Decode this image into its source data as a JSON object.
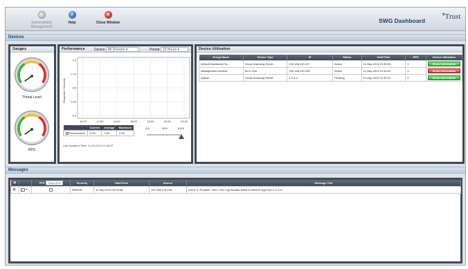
{
  "toolbar": {
    "buttons": [
      {
        "label": "Vulnerability Management",
        "icon": "gray-circle-icon"
      },
      {
        "label": "Help",
        "icon": "help-icon",
        "glyph": "?"
      },
      {
        "label": "Close Window",
        "icon": "close-icon",
        "glyph": "✕"
      }
    ],
    "title": "SWG Dashboard",
    "logo_text": "Trust"
  },
  "sections": {
    "devices": "Devices",
    "messages": "Messages"
  },
  "gauges": {
    "title": "Gauges",
    "items": [
      {
        "label": "Threat Level",
        "value": 0.3
      },
      {
        "label": "RPS",
        "value": 0.3
      }
    ]
  },
  "performance": {
    "title": "Performance",
    "device_label": "Device",
    "device_value": "All Devices",
    "period_label": "Period",
    "period_value": "10 Hours",
    "y_axis_label": "Requests / Seconds",
    "y_ticks": [
      "1.0",
      "0.75",
      "0.5",
      "0.25",
      "0.0"
    ],
    "x_ticks": [
      "10:00",
      "12:00",
      "14:00",
      "16:00",
      "18:00",
      "20:00",
      "22:00"
    ],
    "table_headers": [
      "",
      "Current",
      "Average",
      "Maximum"
    ],
    "table_row": [
      "Performance",
      "0.00",
      "0.00",
      "0.00"
    ],
    "slider_ticks": [
      "0%",
      "50%",
      "100%"
    ],
    "last_updated": "Last Updated Time: 11-09-2013 21:38:37"
  },
  "device_util": {
    "title": "Device Utilization",
    "headers": [
      "Group Name",
      "Device Type",
      "IP",
      "Status",
      "Date/Time",
      "RPS",
      "Device Utilization"
    ],
    "rows": [
      {
        "cells": [
          "Default Distributed Sc...",
          "Cloud Scanning Server",
          "192.168.120.127",
          "Active",
          "11-Sep-2013 21:39:09",
          "0"
        ],
        "action": "Show Information",
        "action_color": "green"
      },
      {
        "cells": [
          "Management Devices",
          "All In One",
          "192.168.120.128",
          "Active",
          "11-Sep-2013 21:34:04",
          "0"
        ],
        "action": "Show Information",
        "action_color": "red"
      },
      {
        "cells": [
          "mgtroh",
          "Cloud Scanning Server",
          "1.2.3.4",
          "Pending",
          "11-Sep-2013 21:39:31",
          "0"
        ],
        "action": "Show Information",
        "action_color": "green"
      }
    ]
  },
  "messages": {
    "headers": [
      "",
      "",
      "ACK",
      "Security",
      "Date/Time",
      "Source",
      "Message Text"
    ],
    "ack_filter": "Show All",
    "rows": [
      {
        "count": "2",
        "severity": "ERROR",
        "datetime": "11-Sep-2013 20:04:36",
        "source": "192.168.120.128",
        "text": "event: 4, Problem: 1622: The Log Handler failed to retrieve logs from 1.2.3.4."
      }
    ]
  },
  "colors": {
    "accent": "#1d3f73",
    "panel_border": "#3f4a56",
    "ok_green": "#2fb42f",
    "alert_red": "#d23a3a"
  }
}
